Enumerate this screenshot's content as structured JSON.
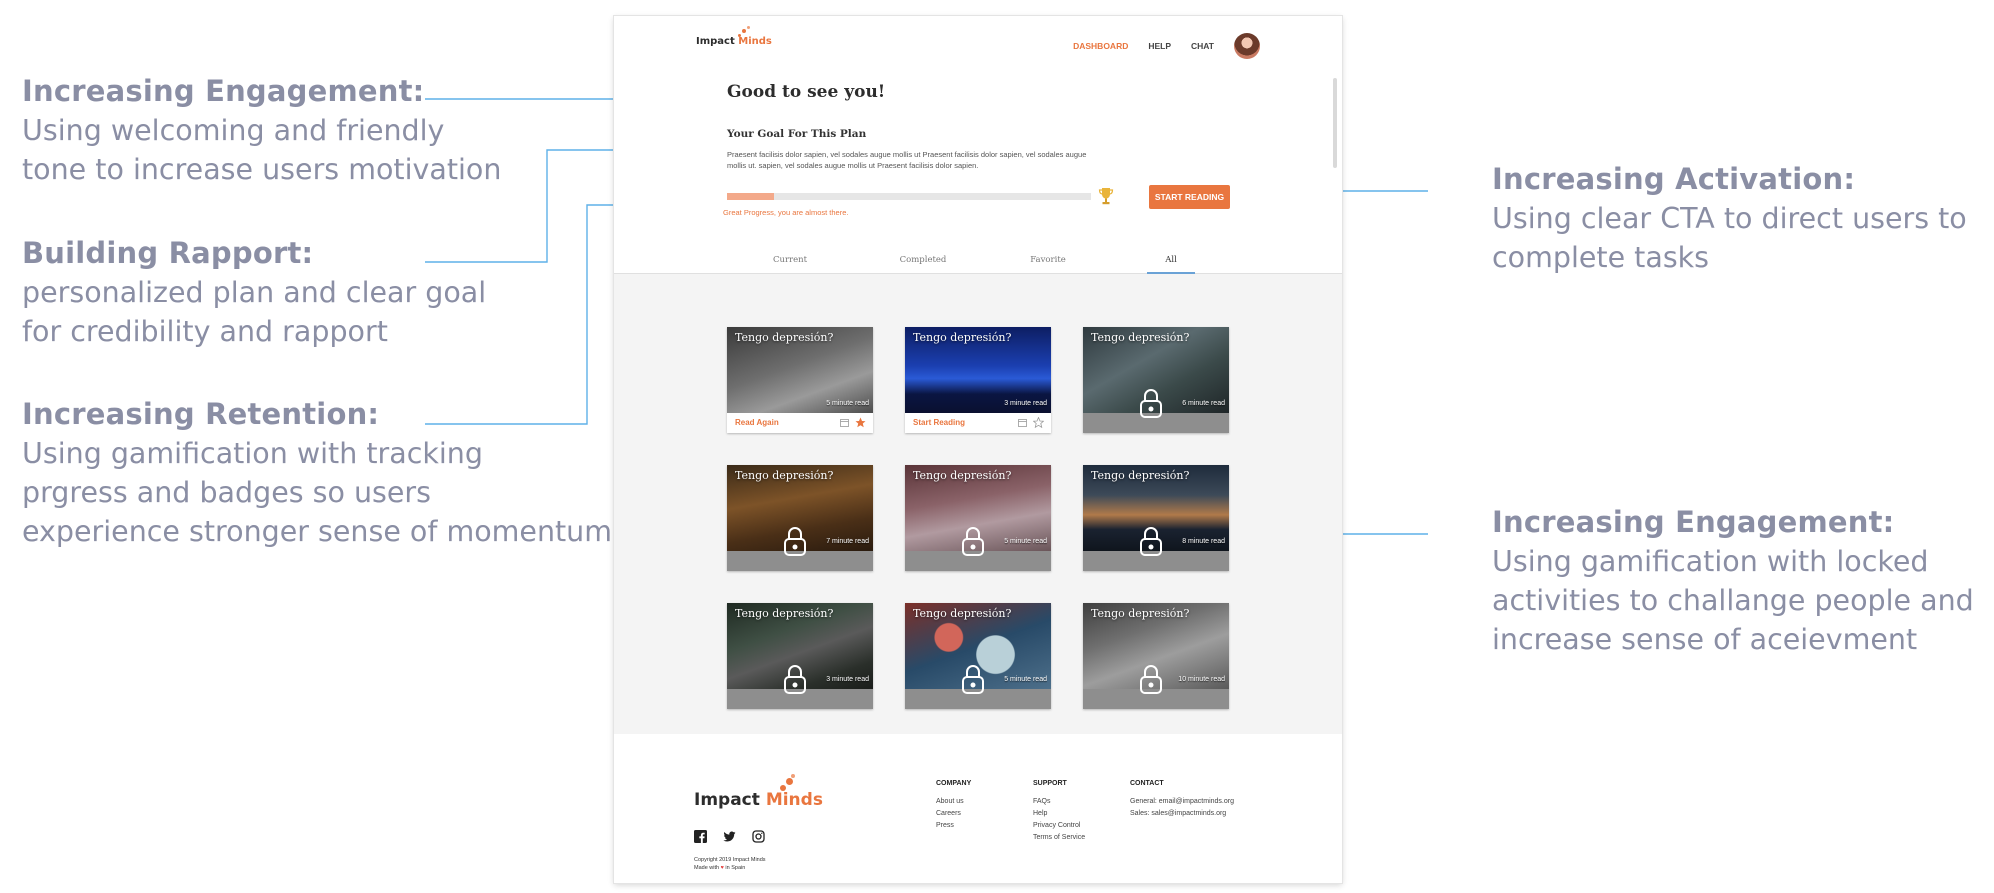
{
  "annotations": [
    {
      "title": "Increasing Engagement:",
      "lines": [
        "Using welcoming and friendly",
        "tone to increase users motivation"
      ]
    },
    {
      "title": "Building Rapport:",
      "lines": [
        "personalized plan and clear goal",
        "for credibility and rapport"
      ]
    },
    {
      "title": "Increasing Retention:",
      "lines": [
        "Using gamification with tracking",
        "prgress and badges so users",
        "experience stronger sense of momentum"
      ]
    },
    {
      "title": "Increasing Activation:",
      "lines": [
        "Using clear CTA to direct users to",
        "complete tasks"
      ]
    },
    {
      "title": "Increasing Engagement:",
      "lines": [
        "Using gamification with locked",
        "activities to challange people and",
        "increase sense of aceievment"
      ]
    }
  ],
  "brand": {
    "part1": "Impact",
    "part2": "Minds",
    "accent_color": "#e9763f"
  },
  "nav": {
    "dashboard": "DASHBOARD",
    "help": "HELP",
    "chat": "CHAT"
  },
  "hero": {
    "greeting": "Good to see you!",
    "goal_title": "Your Goal For This Plan",
    "goal_text": "Praesent facilisis dolor sapien, vel sodales augue mollis ut Praesent facilisis dolor sapien, vel sodales augue mollis ut. sapien, vel sodales augue mollis ut Praesent facilisis dolor sapien.",
    "progress_fraction": 0.13,
    "progress_message": "Great Progress, you are almost there.",
    "cta_label": "START READING"
  },
  "tabs": [
    "Current",
    "Completed",
    "Favorite",
    "All"
  ],
  "active_tab": "All",
  "cards": [
    {
      "title": "Tengo depresión?",
      "read_time": "5 minute read",
      "action": "Read Again",
      "locked": false,
      "favorite": true
    },
    {
      "title": "Tengo depresión?",
      "read_time": "3 minute read",
      "action": "Start Reading",
      "locked": false,
      "favorite": false
    },
    {
      "title": "Tengo depresión?",
      "read_time": "6 minute read",
      "locked": true
    },
    {
      "title": "Tengo depresión?",
      "read_time": "7 minute read",
      "locked": true
    },
    {
      "title": "Tengo depresión?",
      "read_time": "5 minute read",
      "locked": true
    },
    {
      "title": "Tengo depresión?",
      "read_time": "8 minute read",
      "locked": true
    },
    {
      "title": "Tengo depresión?",
      "read_time": "3 minute read",
      "locked": true
    },
    {
      "title": "Tengo depresión?",
      "read_time": "5 minute read",
      "locked": true
    },
    {
      "title": "Tengo depresión?",
      "read_time": "10 minute read",
      "locked": true
    }
  ],
  "footer": {
    "company": {
      "heading": "COMPANY",
      "links": [
        "About us",
        "Careers",
        "Press"
      ]
    },
    "support": {
      "heading": "SUPPORT",
      "links": [
        "FAQs",
        "Help",
        "Privacy Control",
        "Terms of Service"
      ]
    },
    "contact": {
      "heading": "CONTACT",
      "lines": [
        "General: email@impactminds.org",
        "Sales: sales@impactminds.org"
      ]
    },
    "copyright": "Copyright 2019 Impact Minds",
    "made_with": "Made with",
    "made_in": "in Spain",
    "social_icons": [
      "facebook-icon",
      "twitter-icon",
      "instagram-icon"
    ]
  }
}
